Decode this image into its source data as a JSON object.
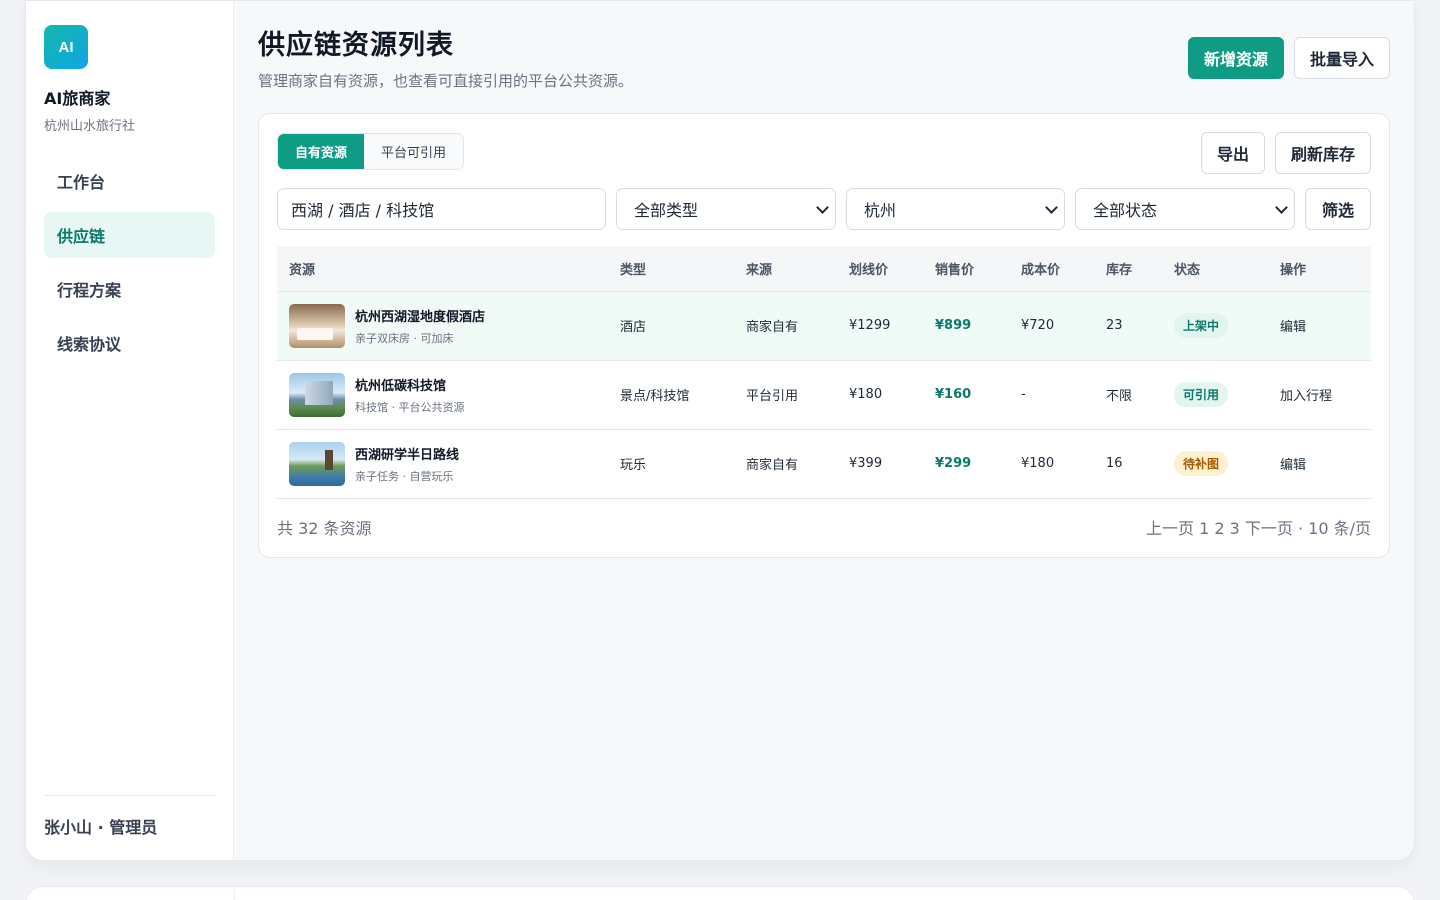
{
  "brand": {
    "logo": "AI",
    "name": "AI旅商家",
    "org": "杭州山水旅行社"
  },
  "nav": [
    {
      "label": "工作台"
    },
    {
      "label": "供应链"
    },
    {
      "label": "行程方案"
    },
    {
      "label": "线索协议"
    }
  ],
  "user": {
    "label": "张小山 · 管理员"
  },
  "page": {
    "title": "供应链资源列表",
    "subtitle": "管理商家自有资源，也查看可直接引用的平台公共资源。",
    "add_label": "新增资源",
    "import_label": "批量导入"
  },
  "tabs": [
    {
      "label": "自有资源"
    },
    {
      "label": "平台可引用"
    }
  ],
  "card_actions": {
    "export_label": "导出",
    "refresh_label": "刷新库存"
  },
  "filters": {
    "keyword": "西湖 / 酒店 / 科技馆",
    "type": "全部类型",
    "city": "杭州",
    "status": "全部状态",
    "filter_label": "筛选"
  },
  "table": {
    "headers": [
      "资源",
      "类型",
      "来源",
      "划线价",
      "销售价",
      "成本价",
      "库存",
      "状态",
      "操作"
    ],
    "rows": [
      {
        "name": "杭州西湖湿地度假酒店",
        "sub": "亲子双床房 · 可加床",
        "type": "酒店",
        "source": "商家自有",
        "list_price": "¥1299",
        "sale_price": "¥899",
        "cost": "¥720",
        "stock": "23",
        "status": "上架中",
        "action": "编辑"
      },
      {
        "name": "杭州低碳科技馆",
        "sub": "科技馆 · 平台公共资源",
        "type": "景点/科技馆",
        "source": "平台引用",
        "list_price": "¥180",
        "sale_price": "¥160",
        "cost": "-",
        "stock": "不限",
        "status": "可引用",
        "action": "加入行程"
      },
      {
        "name": "西湖研学半日路线",
        "sub": "亲子任务 · 自营玩乐",
        "type": "玩乐",
        "source": "商家自有",
        "list_price": "¥399",
        "sale_price": "¥299",
        "cost": "¥180",
        "stock": "16",
        "status": "待补图",
        "action": "编辑"
      }
    ]
  },
  "footer": {
    "total": "共 32 条资源",
    "pagination": "上一页 1 2 3 下一页 · 10 条/页"
  },
  "colors": {
    "accent": "#0f9c84",
    "active_nav_bg": "#e8f7f3",
    "warning_bg": "#fdf1cf"
  }
}
